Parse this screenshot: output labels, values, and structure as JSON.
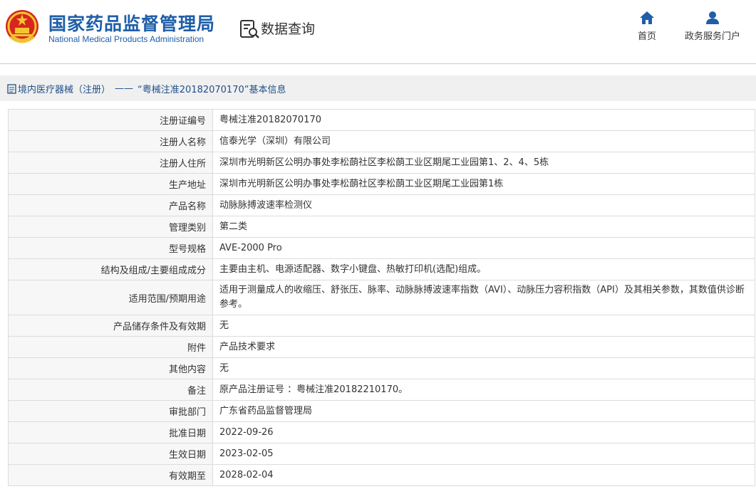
{
  "header": {
    "org_name_cn": "国家药品监督管理局",
    "org_name_en": "National Medical Products Administration",
    "query_title": "数据查询",
    "nav": [
      {
        "label": "首页",
        "icon": "home-icon"
      },
      {
        "label": "政务服务门户",
        "icon": "user-icon"
      }
    ]
  },
  "breadcrumb": {
    "section": "境内医疗器械（注册）",
    "separator": "——",
    "current": "“粤械注准20182070170”基本信息"
  },
  "rows": [
    {
      "label": "注册证编号",
      "value": "粤械注准20182070170"
    },
    {
      "label": "注册人名称",
      "value": "信泰光学（深圳）有限公司"
    },
    {
      "label": "注册人住所",
      "value": "深圳市光明新区公明办事处李松蓢社区李松蓢工业区期尾工业园第1、2、4、5栋"
    },
    {
      "label": "生产地址",
      "value": "深圳市光明新区公明办事处李松蓢社区李松蓢工业区期尾工业园第1栋"
    },
    {
      "label": "产品名称",
      "value": "动脉脉搏波速率检测仪"
    },
    {
      "label": "管理类别",
      "value": "第二类"
    },
    {
      "label": "型号规格",
      "value": "AVE-2000 Pro"
    },
    {
      "label": "结构及组成/主要组成成分",
      "value": "主要由主机、电源适配器、数字小键盘、热敏打印机(选配)组成。"
    },
    {
      "label": "适用范围/预期用途",
      "value": "适用于测量成人的收缩压、舒张压、脉率、动脉脉搏波速率指数（AVI）、动脉压力容积指数（API）及其相关参数，其数值供诊断参考。"
    },
    {
      "label": "产品储存条件及有效期",
      "value": "无"
    },
    {
      "label": "附件",
      "value": "产品技术要求"
    },
    {
      "label": "其他内容",
      "value": "无"
    },
    {
      "label": "备注",
      "value": "原产品注册证号 ：粤械注准20182210170。"
    },
    {
      "label": "审批部门",
      "value": "广东省药品监督管理局"
    },
    {
      "label": "批准日期",
      "value": "2022-09-26"
    },
    {
      "label": "生效日期",
      "value": "2023-02-05"
    },
    {
      "label": "有效期至",
      "value": "2028-02-04"
    }
  ],
  "colors": {
    "brand_blue": "#1f5ea8",
    "emblem_red": "#d7261e",
    "emblem_gold": "#f4c531",
    "label_bg": "#f7f7f7",
    "border": "#dcdcdc"
  }
}
